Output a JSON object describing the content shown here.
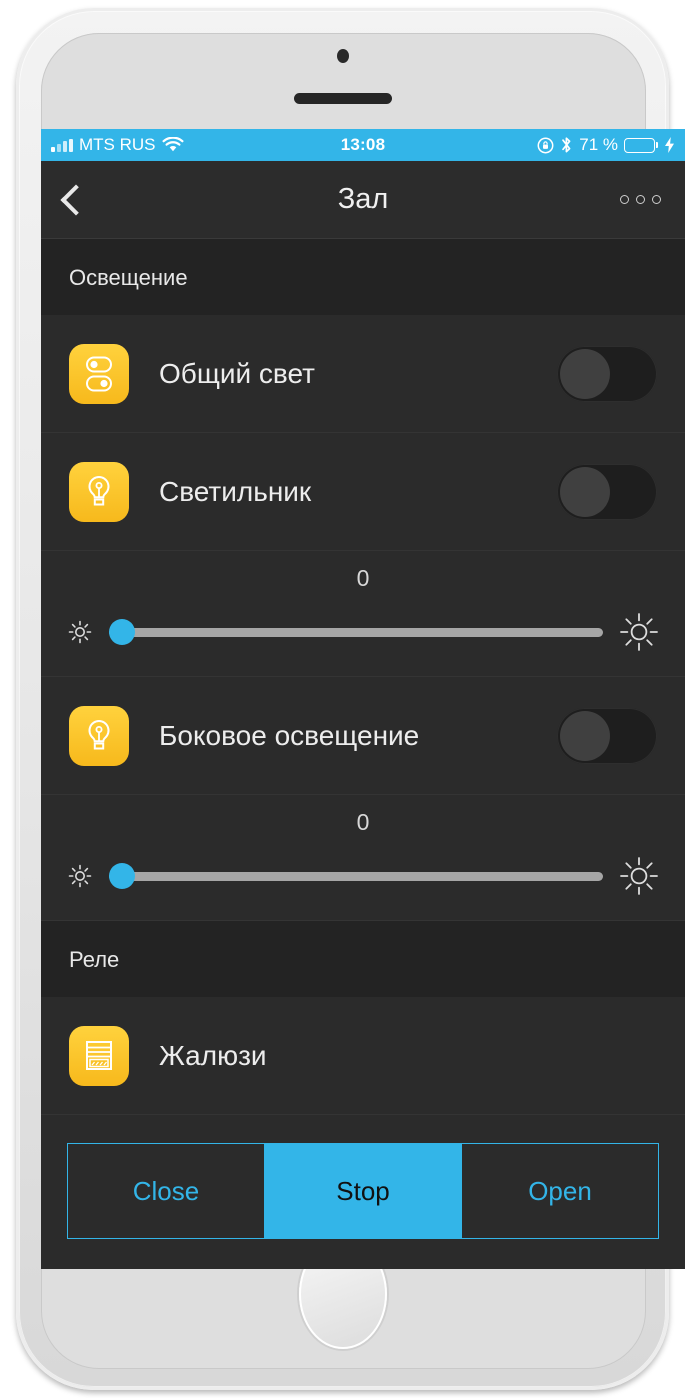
{
  "status_bar": {
    "carrier": "MTS RUS",
    "time": "13:08",
    "battery_percent": "71 %",
    "battery_level": 71,
    "wifi_icon": "wifi-icon",
    "bluetooth_icon": "bluetooth-icon",
    "rotation_lock_icon": "rotation-lock-icon",
    "charging_icon": "lightning-bolt-icon",
    "accent_color": "#33b5e8"
  },
  "nav": {
    "title": "Зал",
    "back_icon": "chevron-left-icon",
    "more_icon": "more-horizontal-icon"
  },
  "sections": [
    {
      "title": "Освещение"
    },
    {
      "title": "Реле"
    }
  ],
  "lighting": {
    "rows": [
      {
        "label": "Общий свет",
        "icon": "double-switch-icon",
        "toggle_state": "off"
      },
      {
        "label": "Светильник",
        "icon": "lightbulb-icon",
        "toggle_state": "off"
      },
      {
        "label": "Боковое освещение",
        "icon": "lightbulb-icon",
        "toggle_state": "off"
      }
    ],
    "sliders": [
      {
        "value": "0",
        "percent": 0,
        "min_icon": "brightness-low-icon",
        "max_icon": "brightness-high-icon"
      },
      {
        "value": "0",
        "percent": 0,
        "min_icon": "brightness-low-icon",
        "max_icon": "brightness-high-icon"
      }
    ]
  },
  "relay": {
    "row": {
      "label": "Жалюзи",
      "icon": "blinds-icon"
    },
    "controls": [
      {
        "label": "Close",
        "selected": false
      },
      {
        "label": "Stop",
        "selected": true
      },
      {
        "label": "Open",
        "selected": false
      }
    ]
  },
  "colors": {
    "accent": "#33b5e8",
    "tile_yellow": "#fbc02d",
    "screen_bg": "#2b2b2b",
    "section_bg": "#232323",
    "battery_green": "#52e05a"
  }
}
